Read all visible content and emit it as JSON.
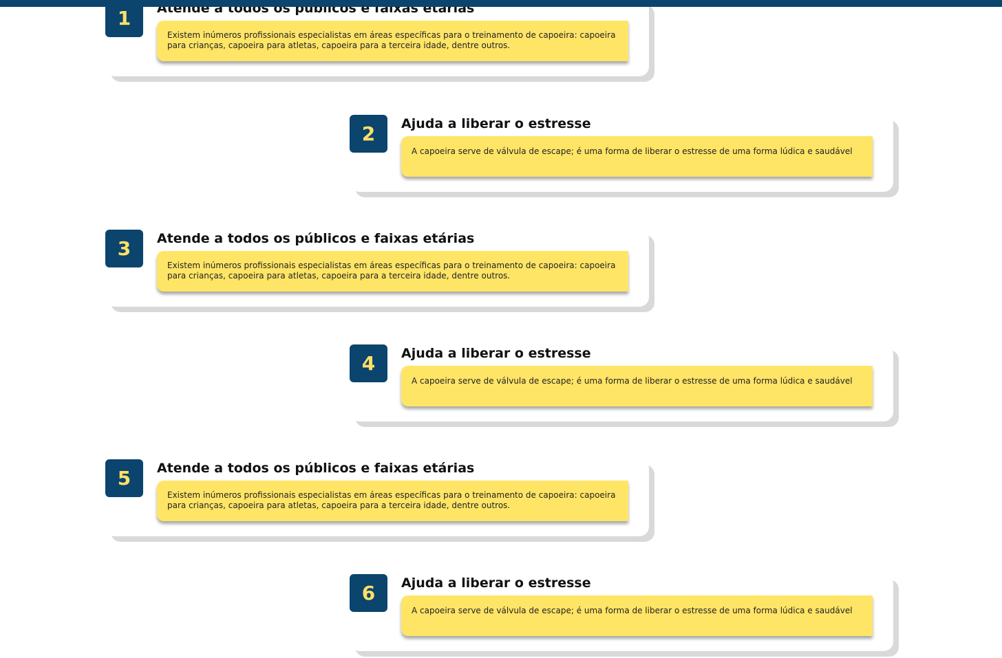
{
  "benefits": [
    {
      "number": "1",
      "title": "Atende a todos os públicos e faixas etárias",
      "description": "Existem inúmeros profissionais especialistas em áreas específicas para o treinamento de capoeira: capoeira para crianças, capoeira para atletas, capoeira para a terceira idade, dentre outros."
    },
    {
      "number": "2",
      "title": "Ajuda a liberar o estresse",
      "description": "A capoeira serve de válvula de escape; é uma forma de liberar o estresse de uma forma lúdica e saudável"
    },
    {
      "number": "3",
      "title": "Atende a todos os públicos e faixas etárias",
      "description": "Existem inúmeros profissionais especialistas em áreas específicas para o treinamento de capoeira: capoeira para crianças, capoeira para atletas, capoeira para a terceira idade, dentre outros."
    },
    {
      "number": "4",
      "title": "Ajuda a liberar o estresse",
      "description": "A capoeira serve de válvula de escape; é uma forma de liberar o estresse de uma forma lúdica e saudável"
    },
    {
      "number": "5",
      "title": "Atende a todos os públicos e faixas etárias",
      "description": "Existem inúmeros profissionais especialistas em áreas específicas para o treinamento de capoeira: capoeira para crianças, capoeira para atletas, capoeira para a terceira idade, dentre outros."
    },
    {
      "number": "6",
      "title": "Ajuda a liberar o estresse",
      "description": "A capoeira serve de válvula de escape; é uma forma de liberar o estresse de uma forma lúdica e saudável"
    }
  ],
  "colors": {
    "number_box": "#0b446d",
    "number_text": "#ffe066",
    "description_bg": "#ffe566",
    "top_bar": "#0b446d"
  }
}
